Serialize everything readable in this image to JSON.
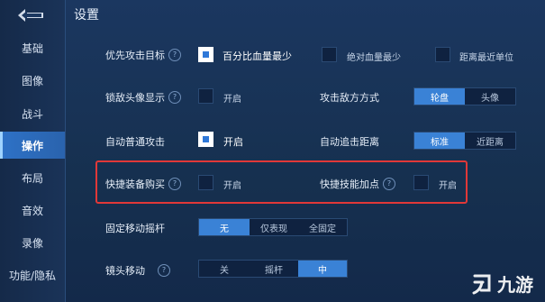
{
  "page_title": "设置",
  "sidebar": {
    "items": [
      {
        "label": "基础",
        "active": false
      },
      {
        "label": "图像",
        "active": false
      },
      {
        "label": "战斗",
        "active": false
      },
      {
        "label": "操作",
        "active": true
      },
      {
        "label": "布局",
        "active": false
      },
      {
        "label": "音效",
        "active": false
      },
      {
        "label": "录像",
        "active": false
      },
      {
        "label": "功能/隐私",
        "active": false
      }
    ]
  },
  "settings": {
    "target_priority": {
      "label": "优先攻击目标",
      "options": [
        {
          "label": "百分比血量最少",
          "checked": true
        },
        {
          "label": "绝对血量最少",
          "checked": false
        },
        {
          "label": "距离最近单位",
          "checked": false
        }
      ]
    },
    "lock_avatar": {
      "label": "锁敌头像显示",
      "option": "开启",
      "checked": false
    },
    "attack_enemy_mode": {
      "label": "攻击敌方方式",
      "segments": [
        "轮盘",
        "头像"
      ],
      "selected": 0
    },
    "auto_attack": {
      "label": "自动普通攻击",
      "option": "开启",
      "checked": true
    },
    "auto_chase": {
      "label": "自动追击距离",
      "segments": [
        "标准",
        "近距离"
      ],
      "selected": 0
    },
    "quick_buy": {
      "label": "快捷装备购买",
      "option": "开启",
      "checked": false
    },
    "quick_skill": {
      "label": "快捷技能加点",
      "option": "开启",
      "checked": false
    },
    "fixed_joystick": {
      "label": "固定移动摇杆",
      "segments": [
        "无",
        "仅表现",
        "全固定"
      ],
      "selected": 0
    },
    "camera_move": {
      "label": "镜头移动",
      "segments": [
        "关",
        "摇杆",
        "中"
      ],
      "selected": 2
    }
  },
  "help_glyph": "?",
  "watermark": {
    "text": "九游"
  },
  "colors": {
    "accent": "#3a82d6",
    "highlight": "#e13838",
    "background": "#1b3760"
  }
}
